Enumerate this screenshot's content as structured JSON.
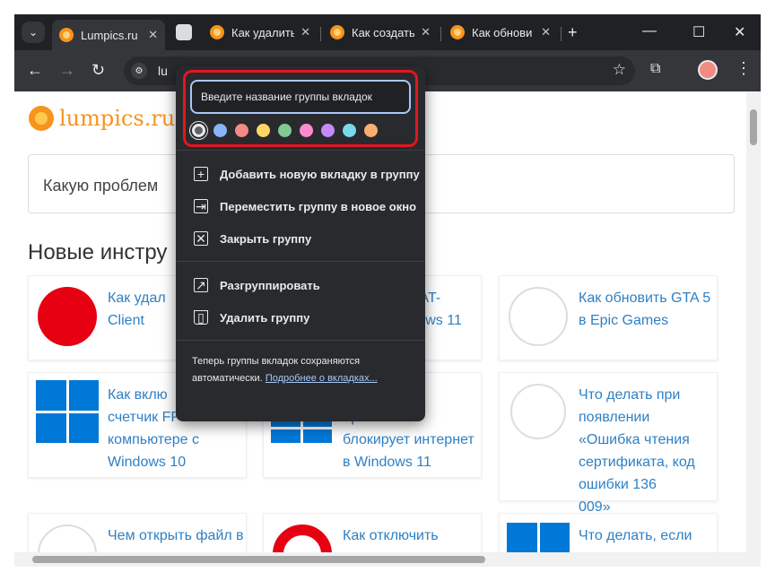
{
  "tabs": [
    {
      "title": "Lumpics.ru",
      "active": true
    },
    {
      "title": "Как удалить",
      "active": false
    },
    {
      "title": "Как создать",
      "active": false
    },
    {
      "title": "Как обнови",
      "active": false
    }
  ],
  "toolbar": {
    "omnibox_text": "lu"
  },
  "page": {
    "logo": "lumpics.ru",
    "search_placeholder": "Какую проблем",
    "section_title": "Новые инстру",
    "cards": [
      {
        "title": "Как удал\nClient"
      },
      {
        "title": "ь BAT-\nindows 11"
      },
      {
        "title": "Как обновить GTA 5 в Epic Games"
      },
      {
        "title": "Как вклю\nсчетчик FPS на\nкомпьютере с\nWindows 10"
      },
      {
        "title": ", если\nКриптоПРО\nблокирует интернет\nв Windows 11"
      },
      {
        "title": "Что делать при\nпоявлении\n«Ошибка чтения\nсертификата, код ошибки 136\n009»"
      },
      {
        "title": "Чем открыть файл в"
      },
      {
        "title": "Как отключить"
      },
      {
        "title": "Что делать, если"
      }
    ]
  },
  "popup": {
    "name_placeholder": "Введите название группы вкладок",
    "colors": [
      "#5f6368",
      "#8ab4f8",
      "#f28b82",
      "#fdd663",
      "#81c995",
      "#ff8bcb",
      "#c58af9",
      "#78d9ec",
      "#fcad70"
    ],
    "colors_names": [
      "grey",
      "blue",
      "red",
      "yellow",
      "green",
      "pink",
      "purple",
      "cyan",
      "orange"
    ],
    "menu": {
      "add_tab": "Добавить новую вкладку в группу",
      "move_group": "Переместить группу в новое окно",
      "close_group": "Закрыть группу",
      "ungroup": "Разгруппировать",
      "delete_group": "Удалить группу"
    },
    "footer_text": "Теперь группы вкладок сохраняются автоматически.",
    "footer_link": "Подробнее о вкладках..."
  }
}
